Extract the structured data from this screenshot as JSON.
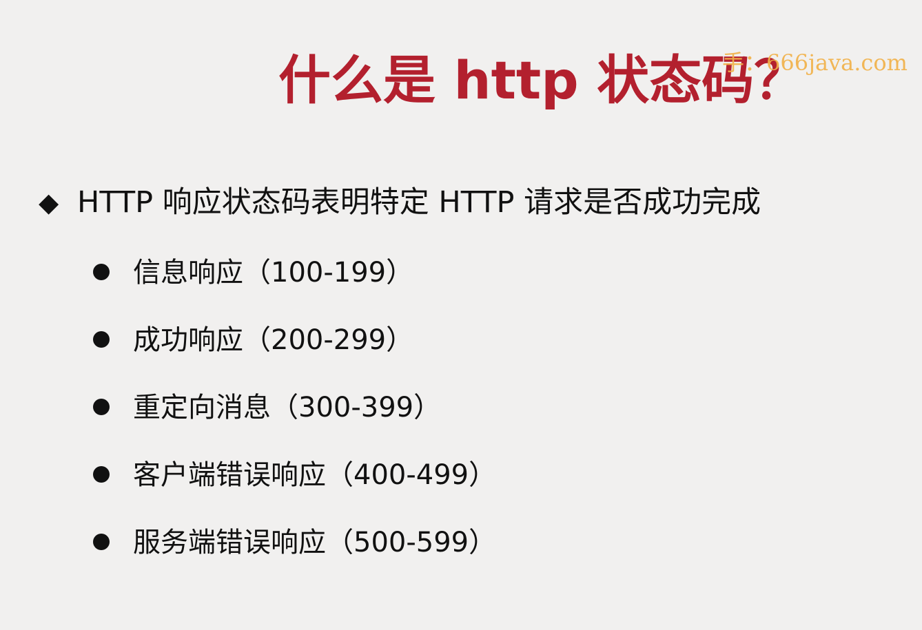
{
  "slide": {
    "title": "什么是 http 状态码？",
    "watermark": "⼿：666java.com",
    "lead": {
      "marker": "◆",
      "text": "HTTP 响应状态码表明特定 HTTP 请求是否成功完成"
    },
    "items": [
      {
        "text": "信息响应（100-199）"
      },
      {
        "text": "成功响应（200-299）"
      },
      {
        "text": "重定向消息（300-399）"
      },
      {
        "text": "客户端错误响应（400-499）"
      },
      {
        "text": "服务端错误响应（500-599）"
      }
    ]
  }
}
